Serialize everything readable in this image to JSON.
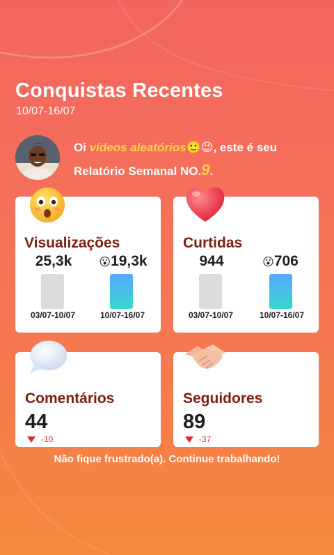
{
  "header": {
    "title": "Conquistas Recentes",
    "date_range": "10/07-16/07"
  },
  "greeting": {
    "prefix": "Oi ",
    "username": "vídeos aleatórios",
    "username_emojis": "🙂😉",
    "middle": ", este é seu Relatório Semanal NO.",
    "report_number": "9",
    "suffix": "."
  },
  "cards": {
    "views": {
      "icon": "surprised-face-icon",
      "title": "Visualizações",
      "prev_value": "25,3k",
      "curr_value": "19,3k",
      "curr_emoji": "😮",
      "prev_label": "03/07-10/07",
      "curr_label": "10/07-16/07"
    },
    "likes": {
      "icon": "heart-icon",
      "title": "Curtidas",
      "prev_value": "944",
      "curr_value": "706",
      "curr_emoji": "😮",
      "prev_label": "03/07-10/07",
      "curr_label": "10/07-16/07"
    },
    "comments": {
      "icon": "speech-bubble-icon",
      "title": "Comentários",
      "value": "44",
      "delta": "-10"
    },
    "followers": {
      "icon": "handshake-icon",
      "title": "Seguidores",
      "value": "89",
      "delta": "-37"
    }
  },
  "footer": {
    "message": "Não fique frustrado(a). Continue trabalhando!"
  },
  "colors": {
    "card_title": "#7b1f12",
    "delta_red": "#e22a22",
    "highlight_yellow": "#ffd24a"
  }
}
